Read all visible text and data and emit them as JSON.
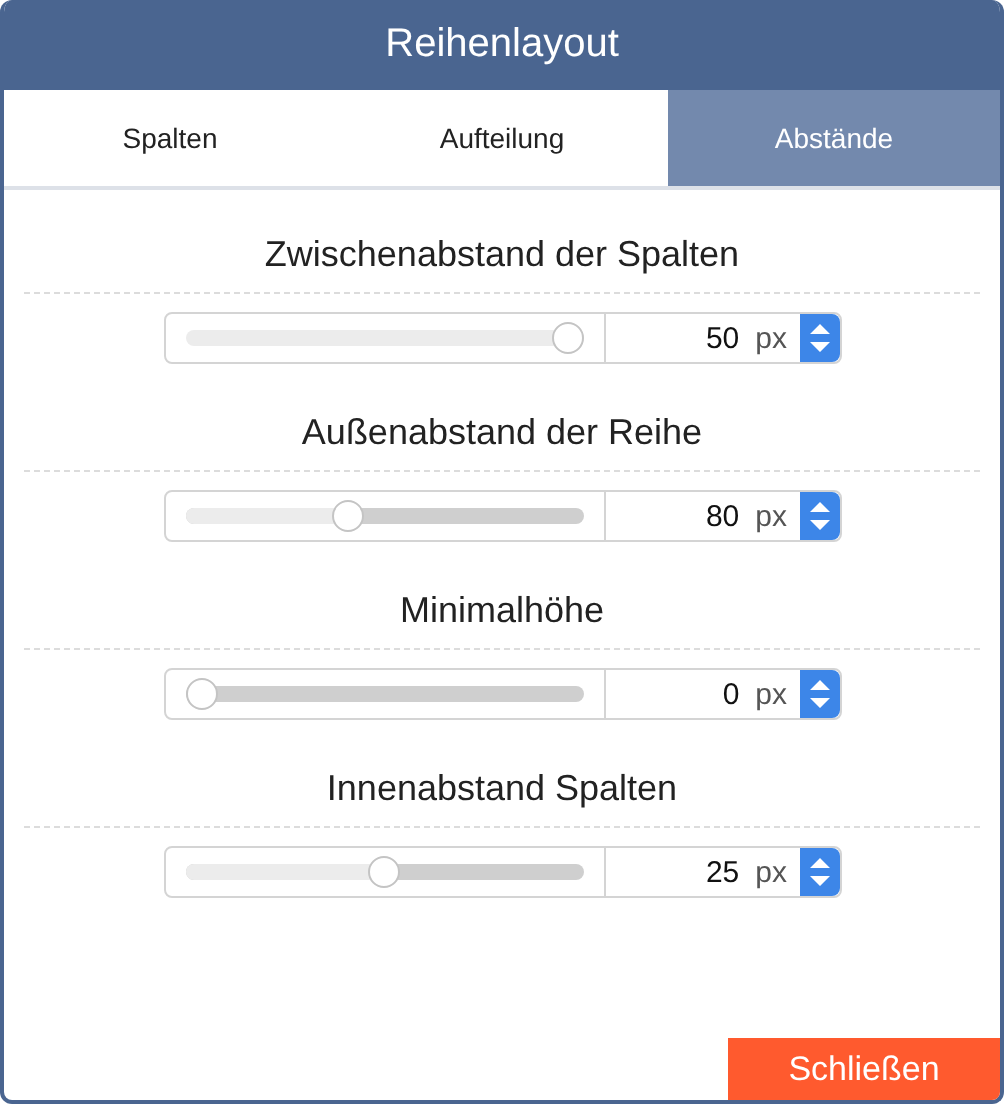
{
  "window": {
    "title": "Reihenlayout"
  },
  "tabs": [
    {
      "label": "Spalten",
      "selected": false
    },
    {
      "label": "Aufteilung",
      "selected": false
    },
    {
      "label": "Abstände",
      "selected": true
    }
  ],
  "settings": [
    {
      "label": "Zwischenabstand der Spalten",
      "level": 1,
      "value": "50",
      "unit": "px"
    },
    {
      "label": "Außenabstand der Reihe",
      "level": 0.4,
      "value": "80",
      "unit": "px"
    },
    {
      "label": "Minimalhöhe",
      "level": 0,
      "value": "0",
      "unit": "px"
    },
    {
      "label": "Innenabstand Spalten",
      "level": 0.5,
      "value": "25",
      "unit": "px"
    }
  ],
  "close_button": "Schließen"
}
